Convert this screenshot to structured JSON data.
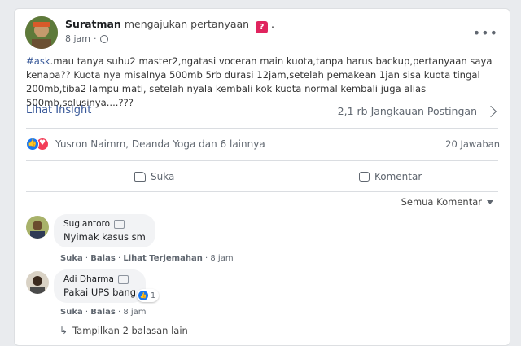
{
  "post": {
    "author": "Suratman",
    "action_text": "mengajukan pertanyaan",
    "action_suffix": ".",
    "time": "8 jam",
    "hashtag": "#ask",
    "text": ".mau tanya suhu2 master2,ngatasi voceran main kuota,tanpa harus backup,pertanyaan saya kenapa?? Kuota nya misalnya 500mb 5rb  durasi 12jam,setelah pemakean 1jan sisa kuota tingal 200mb,tiba2 lampu mati, setelah nyala kembali kok kuota normal kembali juga alias 500mb,solusinya....???"
  },
  "insight": {
    "label": "Lihat Insight",
    "reach": "2,1 rb Jangkauan Postingan"
  },
  "reactions": {
    "names": "Yusron Naimm, Deanda Yoga dan 6 lainnya",
    "answers": "20 Jawaban"
  },
  "actions": {
    "like": "Suka",
    "comment": "Komentar"
  },
  "filter": {
    "label": "Semua Komentar"
  },
  "comments": [
    {
      "name": "Sugiantoro",
      "text": "Nyimak kasus sm",
      "like": "Suka",
      "reply": "Balas",
      "translate": "Lihat Terjemahan",
      "time": "8 jam"
    },
    {
      "name": "Adi Dharma",
      "text": "Pakai UPS bang",
      "reaction_count": "1",
      "like": "Suka",
      "reply": "Balas",
      "time": "8 jam"
    }
  ],
  "more_replies": "Tampilkan 2 balasan lain",
  "colors": {
    "link": "#385898",
    "like": "#1877f2",
    "love": "#f33e58",
    "badge": "#e0245e"
  },
  "icons": [
    "globe-icon",
    "more-icon",
    "chevron-right-icon",
    "like-reaction-icon",
    "love-reaction-icon",
    "thumbs-up-icon",
    "comment-icon",
    "caret-down-icon",
    "reply-arrow-icon"
  ]
}
